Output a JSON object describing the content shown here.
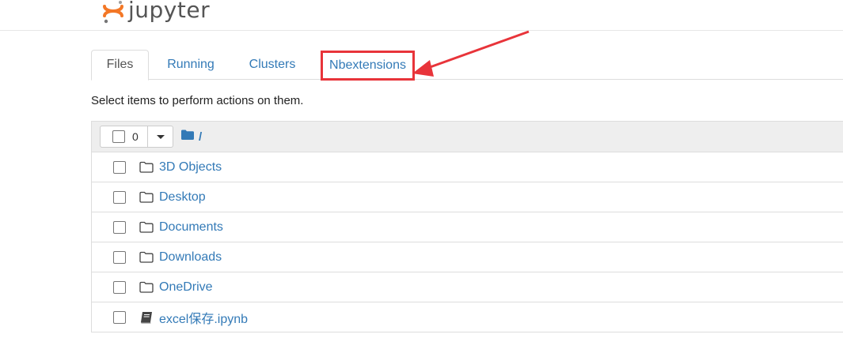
{
  "header": {
    "logo_text": "jupyter",
    "logo_icon": "jupyter-logo-icon"
  },
  "tabs": [
    {
      "label": "Files",
      "active": true
    },
    {
      "label": "Running",
      "active": false
    },
    {
      "label": "Clusters",
      "active": false
    },
    {
      "label": "Nbextensions",
      "active": false
    }
  ],
  "instructions": "Select items to perform actions on them.",
  "list_header": {
    "selected_count": "0",
    "root_path": "/",
    "root_icon": "folder-filled-icon"
  },
  "items": [
    {
      "name": "3D Objects",
      "icon": "folder-icon"
    },
    {
      "name": "Desktop",
      "icon": "folder-icon"
    },
    {
      "name": "Documents",
      "icon": "folder-icon"
    },
    {
      "name": "Downloads",
      "icon": "folder-icon"
    },
    {
      "name": "OneDrive",
      "icon": "folder-icon"
    },
    {
      "name": "excel保存.ipynb",
      "icon": "notebook-icon"
    }
  ],
  "colors": {
    "link": "#337ab7",
    "annotation": "#e8343a",
    "logo_orange": "#f37726"
  }
}
